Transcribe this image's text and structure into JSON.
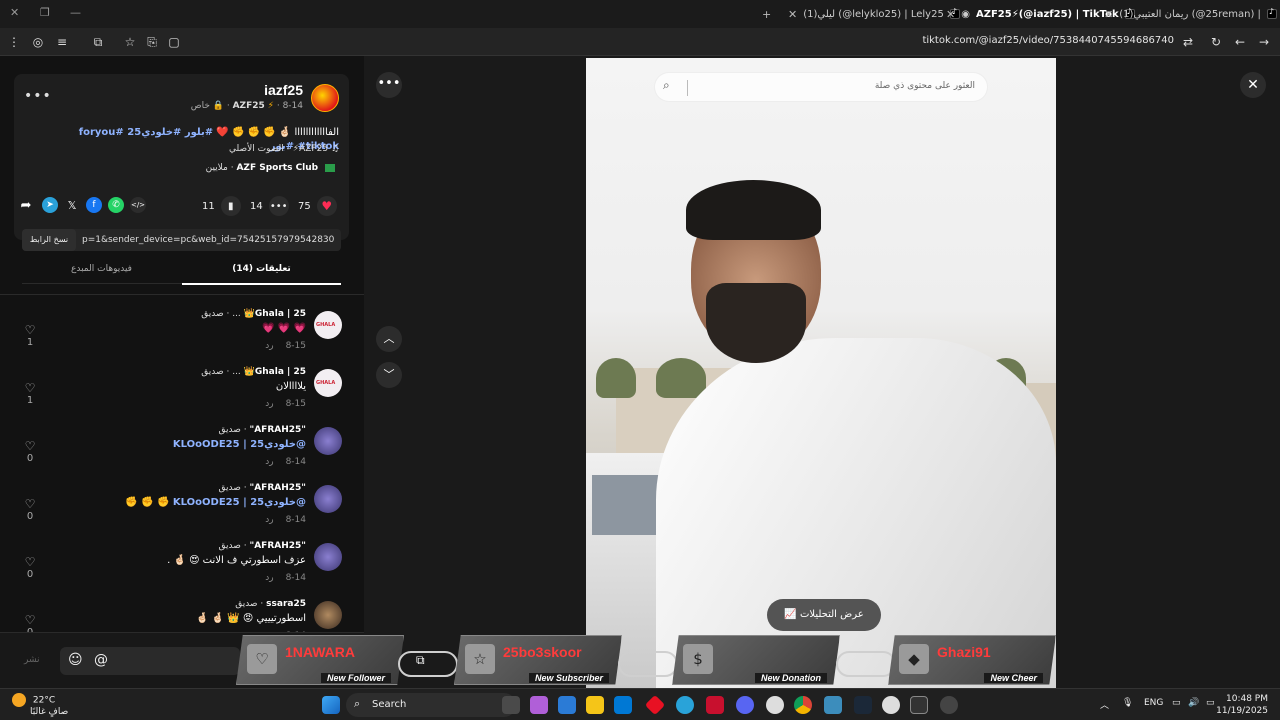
{
  "browser": {
    "tabs": [
      {
        "title": "(1)ريمان العتيبي (@25reman) |",
        "active": false
      },
      {
        "title": "AZF25⚡(@iazf25) | TikTok",
        "active": true
      },
      {
        "title": "(1)ليلي (@lelyklo25) | Lely25",
        "active": false
      }
    ],
    "url": "tiktok.com/@iazf25/video/7538440745594686740"
  },
  "post": {
    "username": "iazf25",
    "display_name": "AZF25",
    "date": "8-14",
    "privacy": "خاص",
    "caption_text": "الفاااااااااااا 🤞🏻 ✊ ✊ ✊ ❤️",
    "caption_tags": "#بلور #خلودي25 #foryou #tiktok #بور",
    "sound": "AZF25⚡ - الصوت الأصلي",
    "club_name": "AZF Sports Club",
    "club_meta": "· ملايين",
    "likes": "75",
    "comments": "14",
    "saves": "11",
    "copy_link_label": "نسخ الرابط",
    "share_url": "p=1&sender_device=pc&web_id=7542515797954283015",
    "tab_comments": "تعليقات (14)",
    "tab_creator_videos": "فيديوهات المبدع"
  },
  "comments": [
    {
      "name": "Ghala | 25👑",
      "prefix": "...",
      "badge": "· صديق",
      "text": "💗 💗 💗",
      "date": "8-15",
      "reply": "رد",
      "likes": "1",
      "avatar": "ghala",
      "link": false
    },
    {
      "name": "Ghala | 25👑",
      "prefix": "...",
      "badge": "· صديق",
      "text": "يلاااالان",
      "date": "8-15",
      "reply": "رد",
      "likes": "1",
      "avatar": "ghala",
      "link": false
    },
    {
      "name": "\"AFRAH25\"",
      "prefix": "",
      "badge": "· صديق",
      "text": "@خلودي25 | KLOoODE25",
      "date": "8-14",
      "reply": "رد",
      "likes": "0",
      "avatar": "afrah",
      "link": true
    },
    {
      "name": "\"AFRAH25\"",
      "prefix": "",
      "badge": "· صديق",
      "text": "@خلودي25 | KLOoODE25 ✊ ✊ ✊",
      "date": "8-14",
      "reply": "رد",
      "likes": "0",
      "avatar": "afrah",
      "link": true
    },
    {
      "name": "\"AFRAH25\"",
      "prefix": "",
      "badge": "· صديق",
      "text": "عزف اسطورتي ف الانت 😍 🤞🏻 .",
      "date": "8-14",
      "reply": "رد",
      "likes": "0",
      "avatar": "afrah",
      "link": false
    },
    {
      "name": "ssara25",
      "prefix": "",
      "badge": "· صديق",
      "text": "اسطورتيييي 😡 👑 🤞🏻 🤞🏻",
      "date": "8-14",
      "reply": "رد",
      "likes": "0",
      "avatar": "ssara",
      "link": false
    }
  ],
  "add_comment": {
    "post_label": "نشر"
  },
  "video": {
    "search_placeholder": "العثور على محتوى ذي صلة",
    "analytics_label": "عرض التحليلات"
  },
  "overlay_alerts": [
    {
      "name": "1NAWARA",
      "label": "New Follower",
      "icon": "heart-icon"
    },
    {
      "name": "25bo3skoor",
      "label": "New Subscriber",
      "icon": "star-icon"
    },
    {
      "name": "",
      "label": "New Donation",
      "icon": "dollar-icon"
    },
    {
      "name": "Ghazi91",
      "label": "New Cheer",
      "icon": "diamond-icon"
    }
  ],
  "taskbar": {
    "temperature": "22°C",
    "weather_text": "صافٍ غالبًا",
    "search_label": "Search",
    "language": "ENG",
    "time": "10:48 PM",
    "date": "11/19/2025"
  }
}
